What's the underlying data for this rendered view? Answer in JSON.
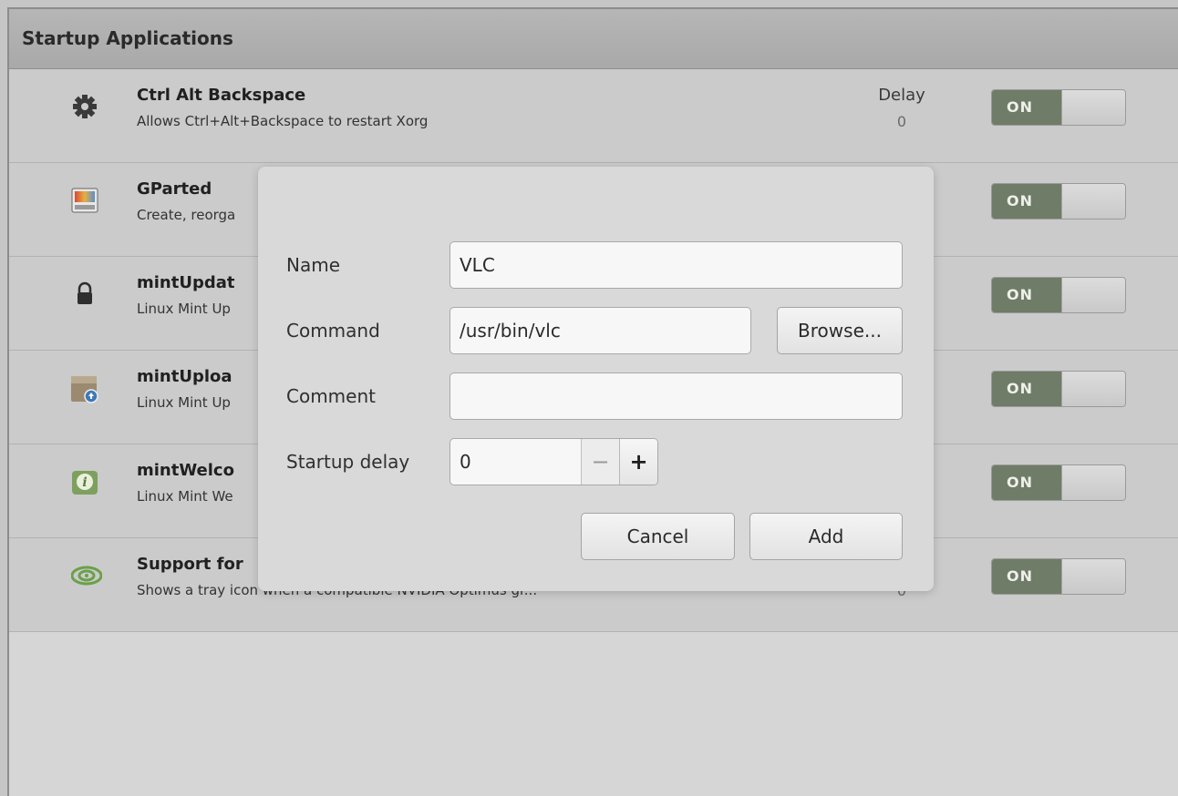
{
  "header": {
    "title": "Startup Applications"
  },
  "apps": [
    {
      "name": "Ctrl Alt Backspace",
      "description": "Allows Ctrl+Alt+Backspace to restart Xorg",
      "delay_label": "Delay",
      "delay_value": "0",
      "toggle": "ON",
      "icon": "gear-icon"
    },
    {
      "name": "GParted",
      "description": "Create, reorga",
      "delay_label": "",
      "delay_value": "",
      "toggle": "ON",
      "icon": "gparted-icon"
    },
    {
      "name": "mintUpdat",
      "description": "Linux Mint Up",
      "delay_label": "",
      "delay_value": "",
      "toggle": "ON",
      "icon": "lock-icon"
    },
    {
      "name": "mintUploa",
      "description": "Linux Mint Up",
      "delay_label": "",
      "delay_value": "",
      "toggle": "ON",
      "icon": "upload-box-icon"
    },
    {
      "name": "mintWelco",
      "description": "Linux Mint We",
      "delay_label": "",
      "delay_value": "",
      "toggle": "ON",
      "icon": "info-icon"
    },
    {
      "name": "Support for",
      "description": "Shows a tray icon when a compatible NVIDIA Optimus gr...",
      "delay_label": "",
      "delay_value": "0",
      "toggle": "ON",
      "icon": "nvidia-icon"
    }
  ],
  "dialog": {
    "name_label": "Name",
    "name_value": "VLC",
    "command_label": "Command",
    "command_value": "/usr/bin/vlc",
    "browse_label": "Browse...",
    "comment_label": "Comment",
    "comment_value": "",
    "delay_label": "Startup delay",
    "delay_value": "0",
    "minus": "−",
    "plus": "+",
    "cancel_label": "Cancel",
    "add_label": "Add"
  },
  "colors": {
    "toggle_on": "#6f7c68",
    "header_bg": "#b0b0b0"
  }
}
